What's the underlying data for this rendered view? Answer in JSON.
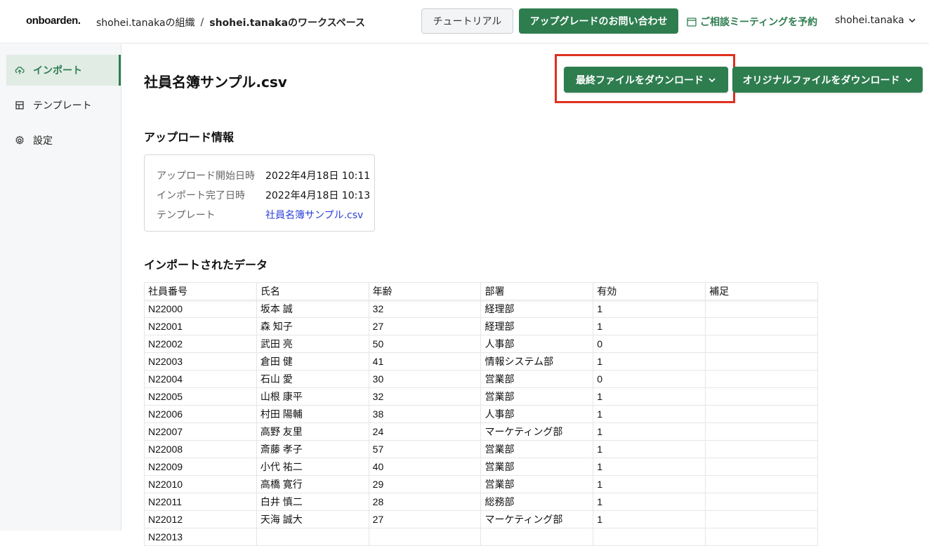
{
  "header": {
    "logo": "onboarden.",
    "org": "shohei.tanakaの組織",
    "separator": "/",
    "workspace": "shohei.tanakaのワークスペース",
    "tutorial_label": "チュートリアル",
    "upgrade_label": "アップグレードのお問い合わせ",
    "meeting_label": "ご相談ミーティングを予約",
    "user_name": "shohei.tanaka"
  },
  "sidebar": {
    "items": [
      {
        "label": "インポート",
        "icon": "cloud-upload-icon",
        "active": true
      },
      {
        "label": "テンプレート",
        "icon": "template-icon",
        "active": false
      },
      {
        "label": "設定",
        "icon": "gear-icon",
        "active": false
      }
    ]
  },
  "main": {
    "file_title": "社員名簿サンプル.csv",
    "download_final_label": "最終ファイルをダウンロード",
    "download_original_label": "オリジナルファイルをダウンロード",
    "upload_info_title": "アップロード情報",
    "upload_info": [
      {
        "key": "アップロード開始日時",
        "value": "2022年4月18日 10:11"
      },
      {
        "key": "インポート完了日時",
        "value": "2022年4月18日 10:13"
      },
      {
        "key": "テンプレート",
        "value": "社員名簿サンプル.csv"
      }
    ],
    "imported_data_title": "インポートされたデータ"
  },
  "table": {
    "columns": [
      "社員番号",
      "氏名",
      "年齢",
      "部署",
      "有効",
      "補足"
    ],
    "rows": [
      [
        "N22000",
        "坂本 誠",
        "32",
        "経理部",
        "1",
        ""
      ],
      [
        "N22001",
        "森 知子",
        "27",
        "経理部",
        "1",
        ""
      ],
      [
        "N22002",
        "武田 亮",
        "50",
        "人事部",
        "0",
        ""
      ],
      [
        "N22003",
        "倉田 健",
        "41",
        "情報システム部",
        "1",
        ""
      ],
      [
        "N22004",
        "石山 愛",
        "30",
        "営業部",
        "0",
        ""
      ],
      [
        "N22005",
        "山根 康平",
        "32",
        "営業部",
        "1",
        ""
      ],
      [
        "N22006",
        "村田 陽輔",
        "38",
        "人事部",
        "1",
        ""
      ],
      [
        "N22007",
        "高野 友里",
        "24",
        "マーケティング部",
        "1",
        ""
      ],
      [
        "N22008",
        "斎藤 孝子",
        "57",
        "営業部",
        "1",
        ""
      ],
      [
        "N22009",
        "小代 祐二",
        "40",
        "営業部",
        "1",
        ""
      ],
      [
        "N22010",
        "高橋 寛行",
        "29",
        "営業部",
        "1",
        ""
      ],
      [
        "N22011",
        "白井 慎二",
        "28",
        "総務部",
        "1",
        ""
      ],
      [
        "N22012",
        "天海 誠大",
        "27",
        "マーケティング部",
        "1",
        ""
      ],
      [
        "N22013",
        "",
        "",
        "",
        "",
        ""
      ]
    ]
  },
  "colors": {
    "accent": "#2e7d4f",
    "highlight": "#e0301e",
    "link": "#2a3fd8"
  }
}
